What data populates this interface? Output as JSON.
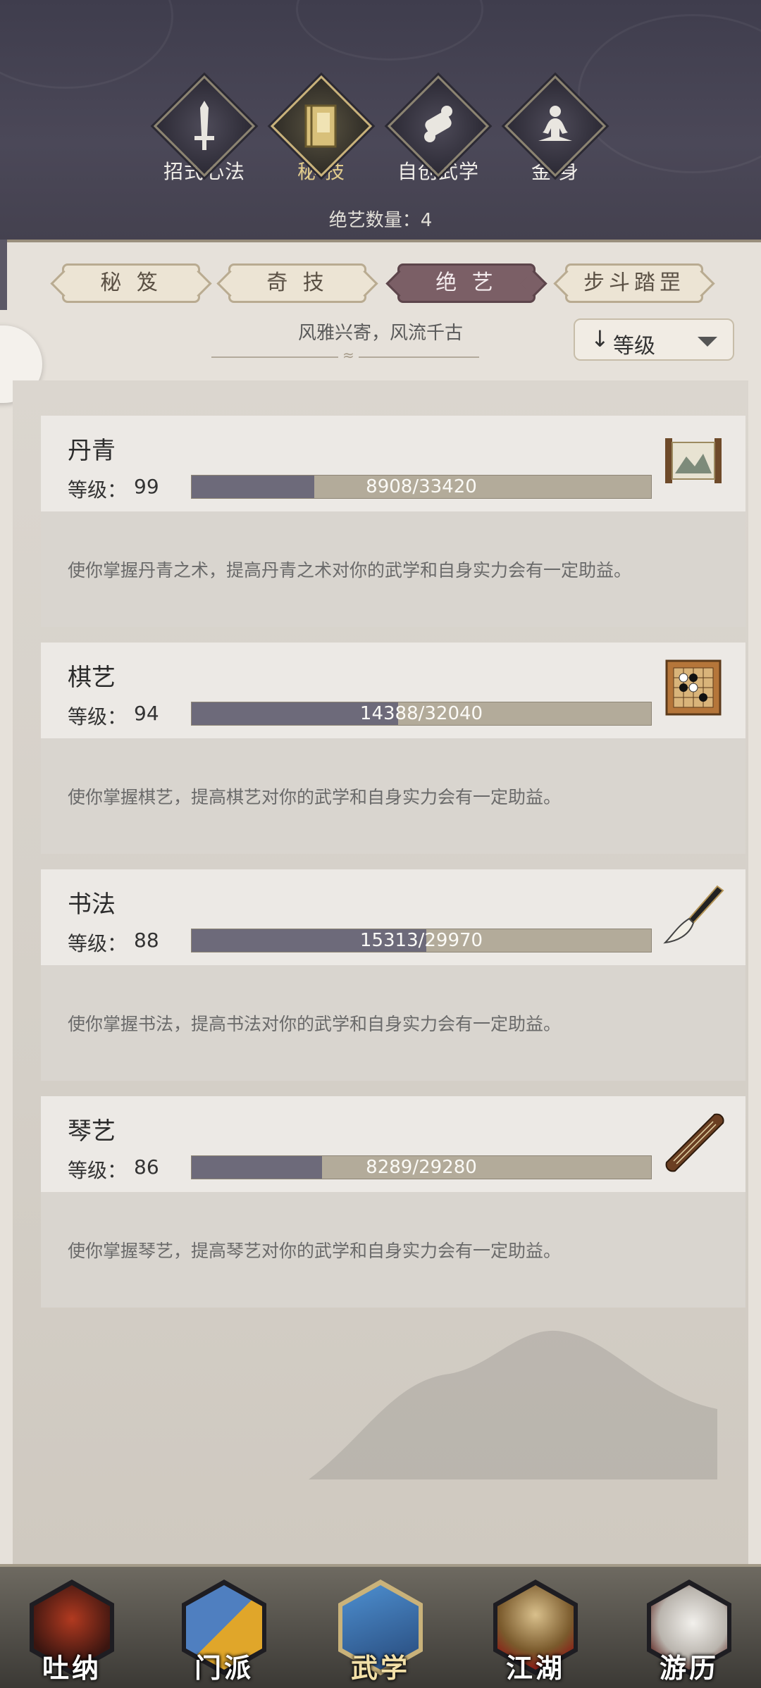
{
  "top_tabs": [
    {
      "label": "招式心法",
      "icon": "sword-icon",
      "active": false
    },
    {
      "label": "秘 技",
      "icon": "book-icon",
      "active": true
    },
    {
      "label": "自创武学",
      "icon": "scroll-icon",
      "active": false
    },
    {
      "label": "金 身",
      "icon": "meditation-icon",
      "active": false
    }
  ],
  "count_label": "绝艺数量：4",
  "sub_tabs": [
    {
      "label": "秘 笈",
      "active": false
    },
    {
      "label": "奇 技",
      "active": false
    },
    {
      "label": "绝 艺",
      "active": true
    },
    {
      "label": "步斗踏罡",
      "active": false
    }
  ],
  "motto": "风雅兴寄，风流千古",
  "sort": {
    "arrow": "↓",
    "label": "等级"
  },
  "skills": [
    {
      "name": "丹青",
      "level_label": "等级：",
      "level": "99",
      "progress_text": "8908/33420",
      "progress": 0.2665,
      "icon": "painting-scroll-icon",
      "description": "使你掌握丹青之术，提高丹青之术对你的武学和自身实力会有一定助益。"
    },
    {
      "name": "棋艺",
      "level_label": "等级：",
      "level": "94",
      "progress_text": "14388/32040",
      "progress": 0.449,
      "icon": "go-board-icon",
      "description": "使你掌握棋艺，提高棋艺对你的武学和自身实力会有一定助益。"
    },
    {
      "name": "书法",
      "level_label": "等级：",
      "level": "88",
      "progress_text": "15313/29970",
      "progress": 0.511,
      "icon": "brush-icon",
      "description": "使你掌握书法，提高书法对你的武学和自身实力会有一定助益。"
    },
    {
      "name": "琴艺",
      "level_label": "等级：",
      "level": "86",
      "progress_text": "8289/29280",
      "progress": 0.283,
      "icon": "guqin-icon",
      "description": "使你掌握琴艺，提高琴艺对你的武学和自身实力会有一定助益。"
    }
  ],
  "bottom_nav": [
    {
      "label": "吐纳",
      "active": false
    },
    {
      "label": "门派",
      "active": false
    },
    {
      "label": "武学",
      "active": true
    },
    {
      "label": "江湖",
      "active": false
    },
    {
      "label": "游历",
      "active": false
    }
  ],
  "colors": {
    "accent": "#7b5f66",
    "bar_fill": "#6d6a7a",
    "bar_bg": "#b3ab9a",
    "header": "#4b4858"
  }
}
